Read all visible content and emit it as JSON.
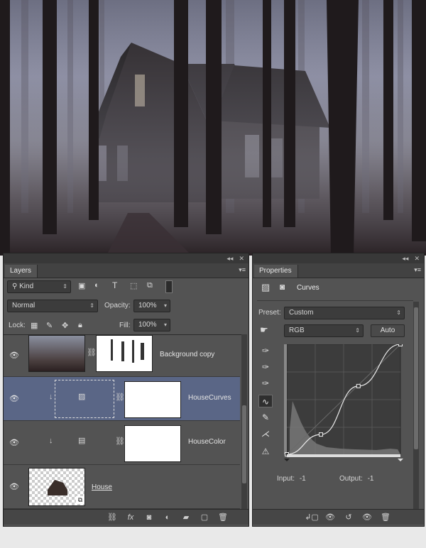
{
  "document": {
    "description_icons": [
      "forest-photo"
    ]
  },
  "layers_panel": {
    "tab_label": "Layers",
    "filter": {
      "icon": "search-icon",
      "value": "Kind"
    },
    "blend_mode": "Normal",
    "opacity_label": "Opacity:",
    "opacity_value": "100%",
    "lock_label": "Lock:",
    "fill_label": "Fill:",
    "fill_value": "100%",
    "layers": [
      {
        "name": "Background copy",
        "selected": false
      },
      {
        "name": "HouseCurves",
        "selected": true
      },
      {
        "name": "HouseColor",
        "selected": false
      },
      {
        "name": "House",
        "selected": false
      }
    ],
    "bottom_icons": [
      "link-icon",
      "fx-icon",
      "mask-icon",
      "adjustment-icon",
      "folder-icon",
      "new-layer-icon",
      "trash-icon"
    ],
    "bottom_fx": "fx"
  },
  "properties_panel": {
    "tab_label": "Properties",
    "title": "Curves",
    "preset_label": "Preset:",
    "preset_value": "Custom",
    "channel_value": "RGB",
    "auto_label": "Auto",
    "input_label": "Input:",
    "input_value": "-1",
    "output_label": "Output:",
    "output_value": "-1",
    "curve_points": [
      [
        0,
        0
      ],
      [
        0.3,
        0.18
      ],
      [
        0.63,
        0.62
      ],
      [
        1,
        1
      ]
    ]
  },
  "colors": {
    "selected_row": "#5a6686",
    "panel_bg": "#535353"
  }
}
